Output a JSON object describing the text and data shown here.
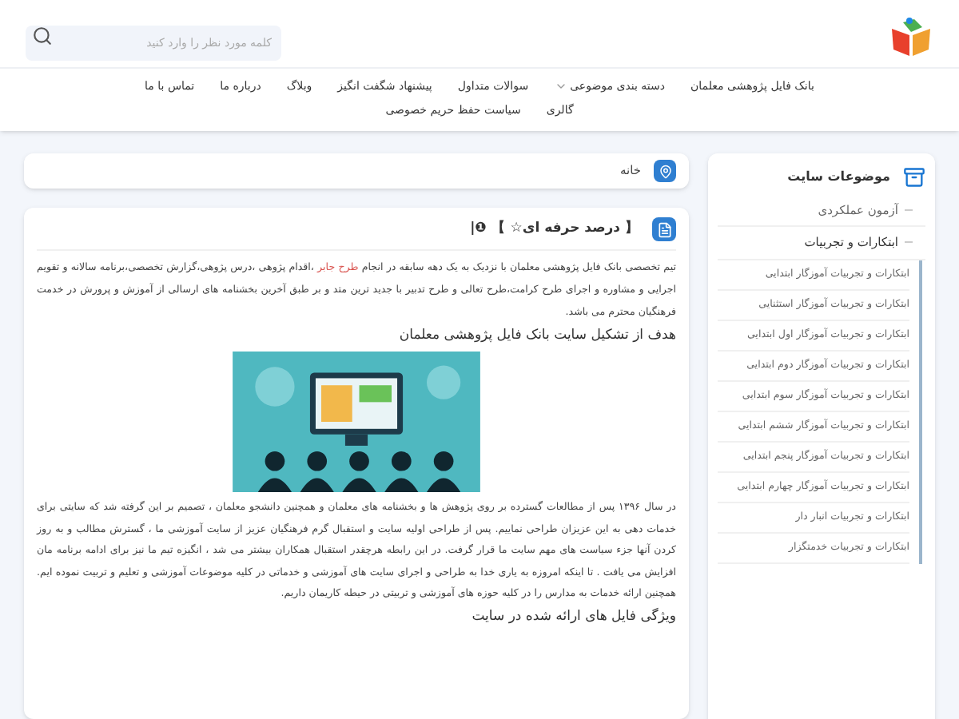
{
  "header": {
    "search": {
      "placeholder": "کلمه مورد نظر را وارد کنید"
    },
    "nav": [
      {
        "label": "بانک فایل پژوهشی معلمان",
        "dropdown": false
      },
      {
        "label": "دسته بندی موضوعی",
        "dropdown": true
      },
      {
        "label": "سوالات متداول",
        "dropdown": false
      },
      {
        "label": "پیشنهاد شگفت انگیز",
        "dropdown": false
      },
      {
        "label": "وبلاگ",
        "dropdown": false
      },
      {
        "label": "درباره ما",
        "dropdown": false
      },
      {
        "label": "تماس با ما",
        "dropdown": false
      },
      {
        "label": "گالری",
        "dropdown": false
      },
      {
        "label": "سیاست حفظ حریم خصوصی",
        "dropdown": false
      }
    ]
  },
  "breadcrumb": {
    "label": "خانه"
  },
  "post": {
    "title": "【 درصد حرفه ای☆ 】 ❶|",
    "intro": {
      "before": "تیم تخصصی بانک فایل پژوهشی معلمان با نزدیک به یک دهه سابقه در انجام ",
      "link": "طرح جابر",
      "after": " ،اقدام پژوهی ،درس پژوهی،گزارش تخصصی،برنامه سالانه و تقویم اجرایی و مشاوره و اجرای طرح کرامت،طرح تعالی و طرح تدبیر با جدید ترین متد و بر طبق آخرین بخشنامه های ارسالی از آموزش و پرورش در خدمت فرهنگیان محترم می باشد."
    },
    "heading1": "هدف از تشکیل سایت بانک فایل پژوهشی معلمان",
    "body": "در سال ۱۳۹۶ پس از مطالعات گسترده بر روی پژوهش ها و بخشنامه های معلمان و همچنین دانشجو معلمان ، تصمیم بر این گرفته شد که سایتی برای خدمات دهی به این عزیزان طراحی نماییم. پس از طراحی اولیه سایت و استقبال گرم فرهنگیان عزیز از سایت آموزشی ما ، گسترش مطالب و به روز کردن آنها جزء سیاست های مهم سایت ما قرار گرفت. در این رابطه هرچقدر استقبال همکاران بیشتر می شد ، انگیزه تیم ما نیز برای ادامه برنامه مان افزایش می یافت . تا اینکه امروزه به یاری خدا به طراحی و اجرای سایت های آموزشی و خدماتی در کلیه موضوعات آموزشی و تعلیم و تربیت نموده ایم. همچنین ارائه خدمات به مدارس را در کلیه حوزه های آموزشی و تربیتی در حیطه کاریمان داریم.",
    "heading2": "ویژگی فایل های ارائه شده در سایت"
  },
  "sidebar": {
    "title": "موضوعات سایت",
    "items": [
      {
        "label": "آزمون عملکردی",
        "expanded": false
      },
      {
        "label": "ابتکارات و تجربیات",
        "expanded": true,
        "children": [
          {
            "label": "ابتکارات و تجربیات آموزگار ابتدایی"
          },
          {
            "label": "ابتکارات و تجربیات آموزگار استثنایی"
          },
          {
            "label": "ابتکارات و تجربیات آموزگار اول ابتدایی"
          },
          {
            "label": "ابتکارات و تجربیات آموزگار دوم ابتدایی"
          },
          {
            "label": "ابتکارات و تجربیات آموزگار سوم ابتدایی"
          },
          {
            "label": "ابتکارات و تجربیات آموزگار ششم ابتدایی"
          },
          {
            "label": "ابتکارات و تجربیات آموزگار پنجم ابتدایی"
          },
          {
            "label": "ابتکارات و تجربیات آموزگار چهارم ابتدایی"
          },
          {
            "label": "ابتکارات و تجربیات انبار دار"
          },
          {
            "label": "ابتکارات و تجربیات خدمتگزار"
          }
        ]
      }
    ]
  }
}
